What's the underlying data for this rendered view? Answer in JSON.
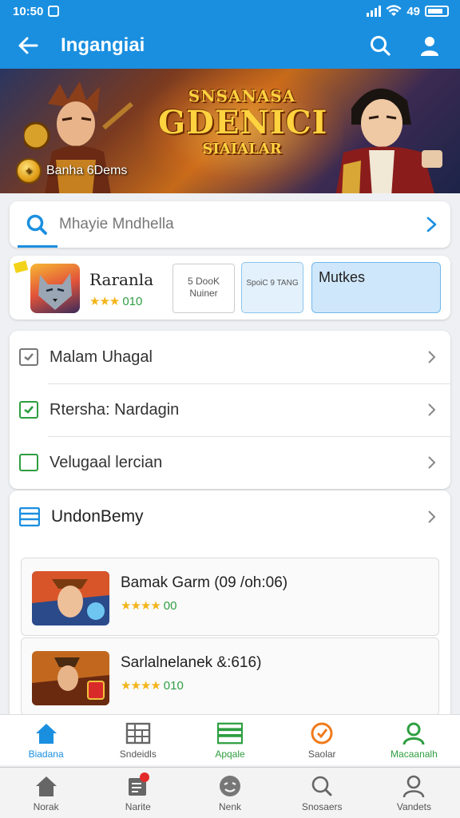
{
  "status_bar": {
    "time": "10:50",
    "battery": "49"
  },
  "app_bar": {
    "title": "Ingangiai"
  },
  "banner": {
    "headline_top": "SNSANASA",
    "headline_main": "GDENICI",
    "headline_bottom": "SIAIALAR",
    "caption": "Banha 6Dems"
  },
  "search": {
    "placeholder": "Mhayie Mndhella"
  },
  "featured": {
    "name": "Raranla",
    "rating": "010",
    "card1_text": "5 DooK Nuiner",
    "card2_text": "SpoiC 9 TANG",
    "card3_text": "Mutkes"
  },
  "menu": {
    "items": [
      {
        "label": "Malam Uhagal"
      },
      {
        "label": "Rtersha: Nardagin"
      },
      {
        "label": "Velugaal lercian"
      }
    ]
  },
  "section": {
    "title": "UndonBemy",
    "games": [
      {
        "name": "Bamak Garm (09 /oh:06)",
        "rating": "00"
      },
      {
        "name": "Sarlalnelanek &:616)",
        "rating": "010"
      }
    ]
  },
  "tabs_primary": [
    {
      "label": "Biadana",
      "color": "#1a8fe0"
    },
    {
      "label": "Sndeidls",
      "color": "#555555"
    },
    {
      "label": "Apqale",
      "color": "#2e9e40"
    },
    {
      "label": "Saolar",
      "color": "#555555"
    },
    {
      "label": "Macaanalh",
      "color": "#2e9e40"
    }
  ],
  "tabs_secondary": [
    {
      "label": "Norak"
    },
    {
      "label": "Narite"
    },
    {
      "label": "Nenk"
    },
    {
      "label": "Snosaers"
    },
    {
      "label": "Vandets"
    }
  ],
  "colors": {
    "primary": "#1a8fe0",
    "green": "#2e9e40",
    "orange": "#f07a1a",
    "star": "#f3b51a"
  }
}
